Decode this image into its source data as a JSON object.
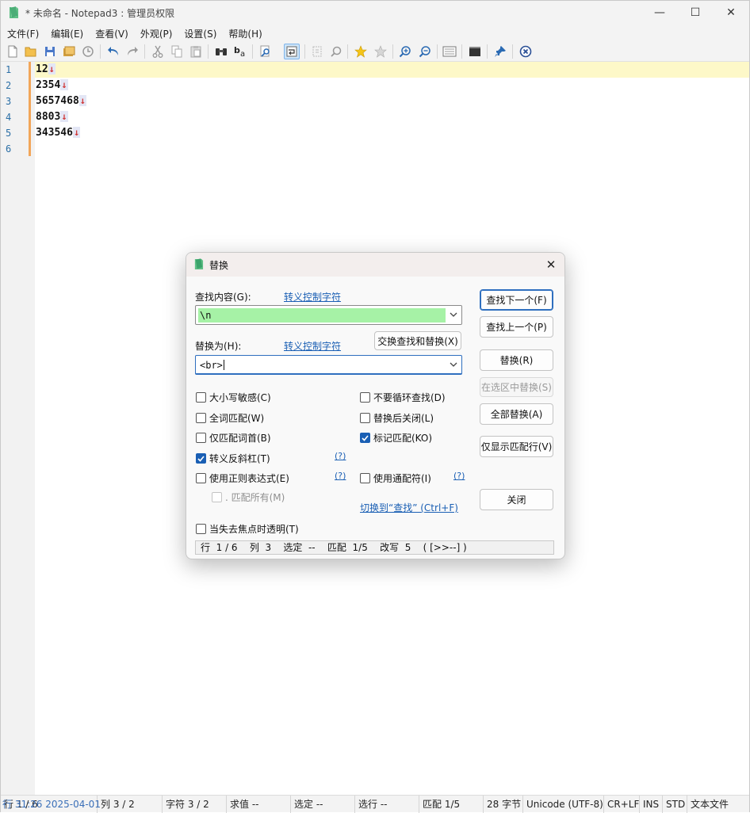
{
  "window": {
    "title": "* 未命名 - Notepad3 : 管理员权限",
    "min_glyph": "—",
    "max_glyph": "☐",
    "close_glyph": "✕"
  },
  "menu": [
    "文件(F)",
    "编辑(E)",
    "查看(V)",
    "外观(P)",
    "设置(S)",
    "帮助(H)"
  ],
  "toolbar": {
    "icons": [
      "new-file-icon",
      "open-folder-icon",
      "save-icon",
      "save-as-icon",
      "revert-icon",
      "undo-icon",
      "redo-icon",
      "cut-icon",
      "copy-icon",
      "paste-icon",
      "find-icon",
      "replace-icon",
      "find-in-files-icon",
      "word-wrap-icon",
      "select-all-icon",
      "zoom-find-icon",
      "favorite-add-icon",
      "favorites-icon",
      "zoom-in-icon",
      "zoom-out-icon",
      "settings-icon",
      "terminal-icon",
      "pin-icon",
      "exit-icon"
    ],
    "active": "word-wrap-icon"
  },
  "editor": {
    "line_numbers": [
      "1",
      "2",
      "3",
      "4",
      "5",
      "6"
    ],
    "lines": [
      "12",
      "2354",
      "5657468",
      "8803",
      "343546",
      ""
    ],
    "eol_glyph": "↓",
    "current_line": 1
  },
  "statusbar": {
    "overlay": "行 31:26 2025-04-01",
    "line": "行 1 / 6",
    "col": "列 3 / 2",
    "chars": "字符 3 / 2",
    "sum": "求值 --",
    "sel": "选定 --",
    "sel_lines": "选行 --",
    "match": "匹配 1/5",
    "bytes": "28 字节",
    "encoding": "Unicode (UTF-8)",
    "eol": "CR+LF",
    "ins": "INS",
    "std": "STD",
    "type": "文本文件"
  },
  "dialog": {
    "title": "替换",
    "find_label": "查找内容(G):",
    "find_link": "转义控制字符",
    "find_value": "\\n",
    "replace_label": "替换为(H):",
    "replace_link": "转义控制字符",
    "replace_value": "<br>",
    "swap_button": "交换查找和替换(X)",
    "buttons": {
      "find_next": "查找下一个(F)",
      "find_prev": "查找上一个(P)",
      "replace": "替换(R)",
      "replace_in_sel": "在选区中替换(S)",
      "replace_all": "全部替换(A)",
      "show_matching": "仅显示匹配行(V)",
      "close": "关闭"
    },
    "options": {
      "match_case": "大小写敏感(C)",
      "whole_word": "全词匹配(W)",
      "word_start": "仅匹配词首(B)",
      "escape_backslash": "转义反斜杠(T)",
      "regex": "使用正则表达式(E)",
      "dot_all": ". 匹配所有(M)",
      "no_wrap": "不要循环查找(D)",
      "close_after": "替换后关闭(L)",
      "mark_matches": "标记匹配(KO)",
      "wildcards": "使用通配符(I)",
      "transparent": "当失去焦点时透明(T)"
    },
    "help_link": "(?)",
    "switch_link": "切换到“查找” (Ctrl+F)",
    "status": "行  1 / 6    列  3    选定  --    匹配  1/5    改写  5    ( [>>--] )"
  }
}
